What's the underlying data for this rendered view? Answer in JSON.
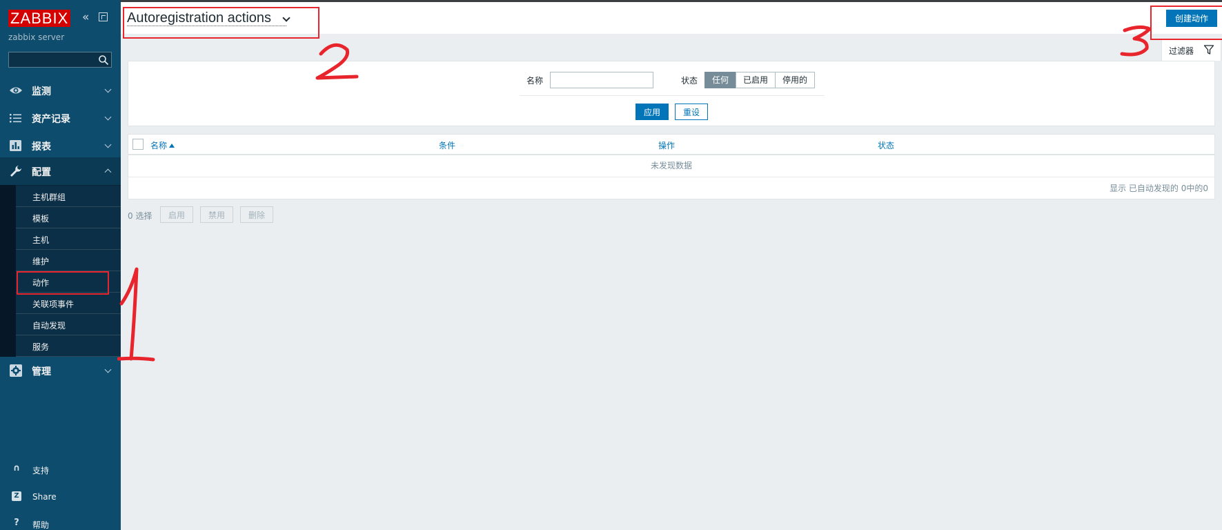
{
  "sidebar": {
    "logo": "ZABBIX",
    "server_name": "zabbix server",
    "search_placeholder": "",
    "menu": [
      {
        "label": "监测",
        "icon": "eye-icon"
      },
      {
        "label": "资产记录",
        "icon": "list-icon"
      },
      {
        "label": "报表",
        "icon": "bar-chart-icon"
      },
      {
        "label": "配置",
        "icon": "wrench-icon"
      },
      {
        "label": "管理",
        "icon": "gear-icon"
      }
    ],
    "submenu": [
      "主机群组",
      "模板",
      "主机",
      "维护",
      "动作",
      "关联项事件",
      "自动发现",
      "服务"
    ],
    "active_submenu": "动作",
    "bottom": [
      {
        "label": "支持",
        "icon": "headset-icon"
      },
      {
        "label": "Share",
        "icon": "share-icon"
      },
      {
        "label": "帮助",
        "icon": "help-icon"
      }
    ]
  },
  "header": {
    "title": "Autoregistration actions",
    "create_button": "创建动作"
  },
  "filter": {
    "tab_label": "过滤器",
    "name_label": "名称",
    "name_value": "",
    "status_label": "状态",
    "status_options": [
      "任何",
      "已启用",
      "停用的"
    ],
    "status_selected": "任何",
    "apply": "应用",
    "reset": "重设"
  },
  "table": {
    "columns": [
      "名称",
      "条件",
      "操作",
      "状态"
    ],
    "sorted_column": "名称",
    "empty_text": "未发现数据",
    "paging": "显示 已自动发现的 0中的0"
  },
  "footer": {
    "selected": "0 选择",
    "buttons": [
      "启用",
      "禁用",
      "删除"
    ]
  },
  "annotations": [
    "1",
    "2",
    "3"
  ],
  "colors": {
    "sidebar": "#0e4c6e",
    "accent": "#0275b8",
    "logo": "#d40000",
    "annotation": "#e8242d"
  }
}
